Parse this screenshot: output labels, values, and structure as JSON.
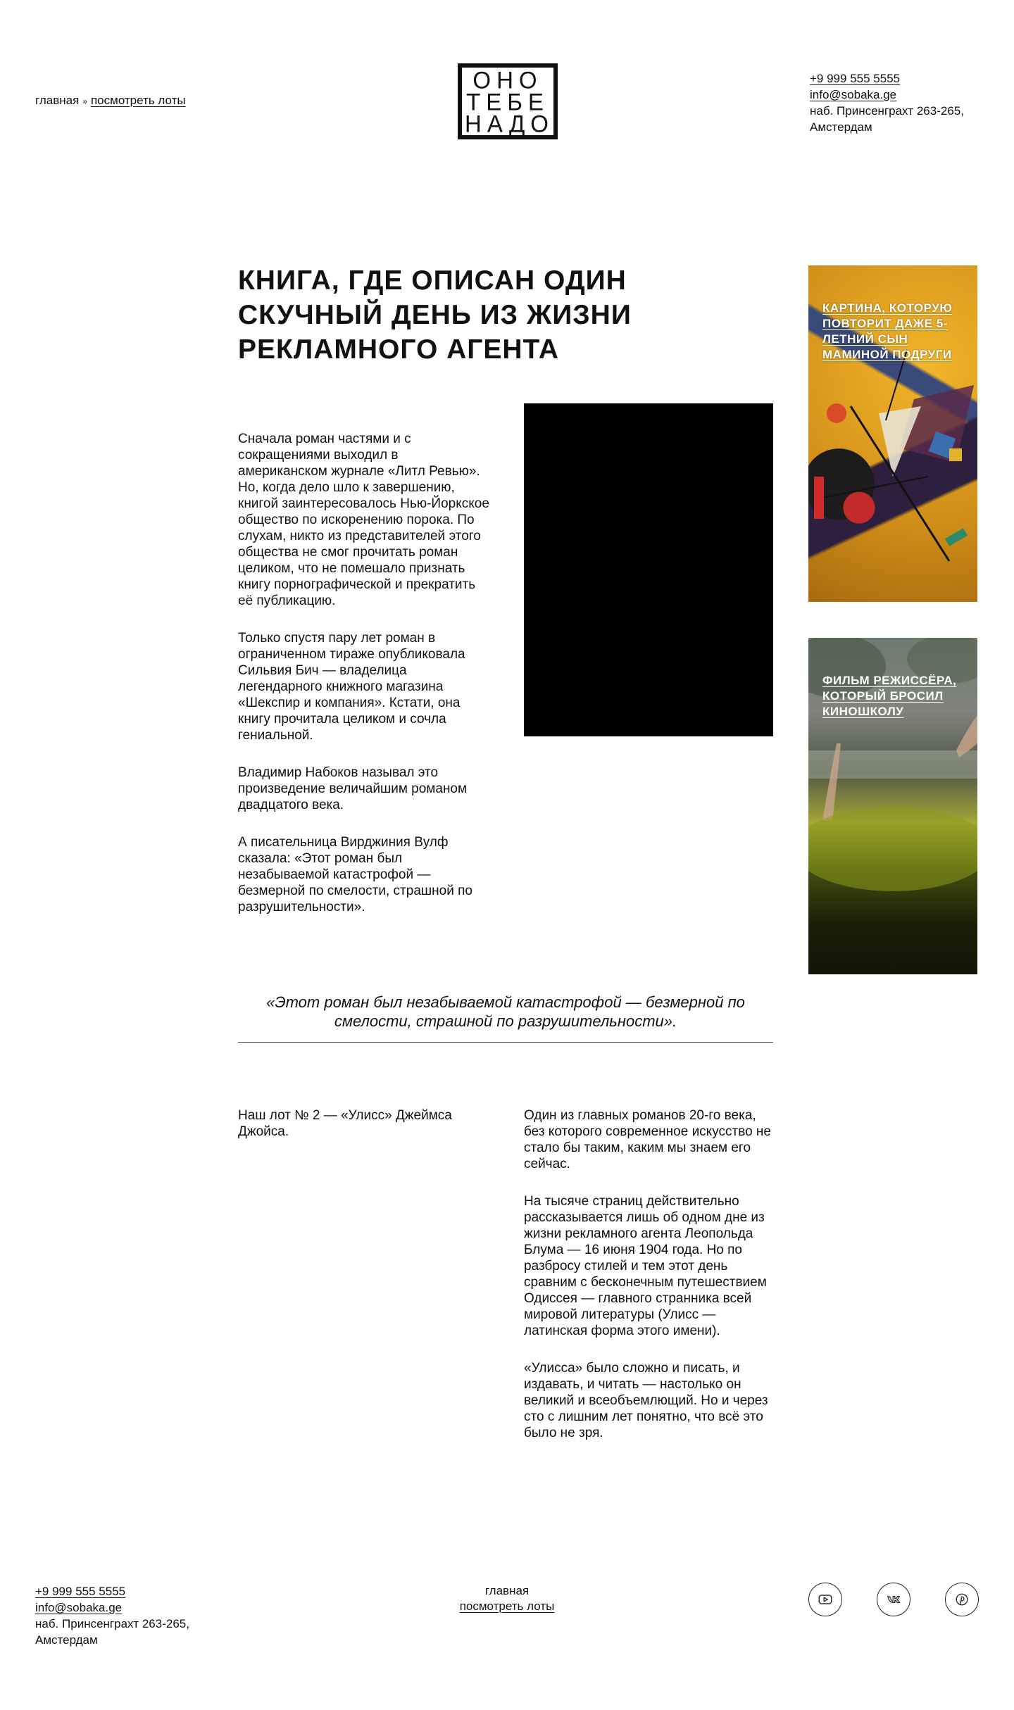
{
  "breadcrumb": {
    "home": "главная",
    "separator": "»",
    "current": "посмотреть лоты"
  },
  "logo": {
    "lines": [
      "ОНО",
      "ТЕБЕ",
      "НАДО"
    ]
  },
  "contacts": {
    "phone": "+9 999 555 5555",
    "email": "info@sobaka.ge",
    "address_line1": "наб. Принсенграхт 263-265,",
    "address_line2": "Амстердам"
  },
  "article": {
    "title": "Книга, где описан один скучный день из жизни рекламного агента",
    "paragraphs": [
      "Сначала роман частями и с сокращениями выходил в американском журнале «Литл Ревью». Но, когда дело шло к завершению, книгой заинтересовалось Нью-Йоркское общество по искоренению порока. По слухам, никто из представителей этого общества не смог прочитать роман целиком, что не помешало признать книгу порнографической и прекратить её публикацию.",
      "Только спустя пару лет роман в ограниченном тираже опубликовала Сильвия Бич — владелица легендарного книжного магазина «Шекспир и компания». Кстати, она книгу прочитала целиком и сочла гениальной.",
      "Владимир Набоков называл это произведение величайшим романом двадцатого века.",
      "А писательница Вирджиния Вулф сказала: «Этот роман был незабываемой катастрофой — безмерной по смелости, страшной по разрушительности»."
    ],
    "quote": "«Этот роман был незабываемой катастрофой — безмерной по смелости, страшной по разрушительности».",
    "lot_label": "Наш лот № 2 — «Улисс» Джеймса Джойса.",
    "lot_paragraphs": [
      "Один из главных романов 20-го века, без которого современное искусство не стало бы таким, каким мы знаем его сейчас.",
      "На тысяче страниц действительно рассказывается лишь об одном дне из жизни рекламного агента Леопольда Блума — 16 июня 1904 года. Но по разбросу стилей и тем этот день сравним с бесконечным путешествием Одиссея — главного странника всей мировой литературы (Улисс — латинская форма этого имени).",
      "«Улисса» было сложно и писать, и издавать, и читать — настолько он великий и всеобъемлющий. Но и через сто с лишним лет понятно, что всё это было не зря."
    ]
  },
  "sidebar": {
    "cards": [
      {
        "caption": "Картина, которую повторит даже 5-летний сын маминой подруги"
      },
      {
        "caption": "Фильм режиссёра, который бросил киношколу"
      }
    ]
  },
  "footer": {
    "nav_home": "главная",
    "nav_lots": "посмотреть лоты",
    "socials": [
      "youtube-icon",
      "vk-icon",
      "pinterest-icon"
    ]
  }
}
